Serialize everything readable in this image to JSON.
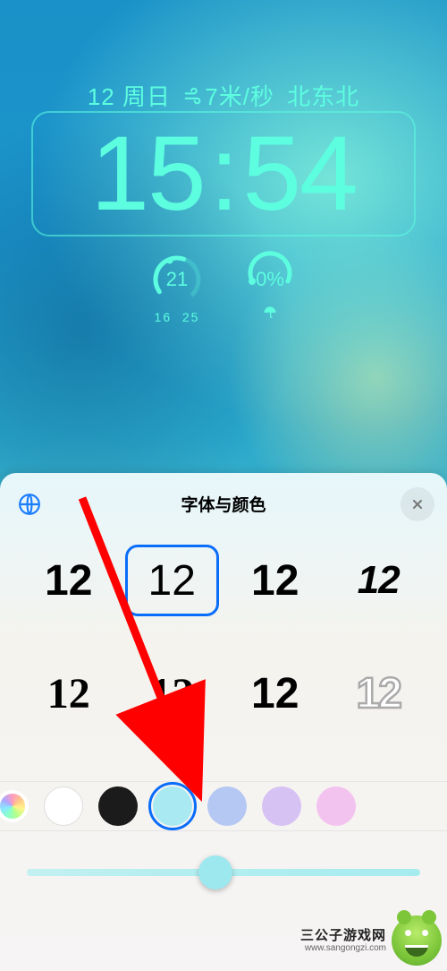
{
  "status_line": {
    "day_number": "12",
    "day_label": "周日",
    "wind_value": "7",
    "wind_unit": "米/秒",
    "wind_dir": "北东北"
  },
  "clock": {
    "hh": "15",
    "mm": "54"
  },
  "gauge_temp": {
    "current": "21",
    "low": "16",
    "high": "25"
  },
  "gauge_rain": {
    "value": "0%"
  },
  "panel": {
    "title": "字体与颜色",
    "sample": "12",
    "selected_font_index": 1,
    "selected_color_index": 2,
    "colors": [
      "#ffffff",
      "#1b1b1b",
      "#a8e9f2",
      "#b4c8f3",
      "#d6c2f3",
      "#f3c3f0"
    ],
    "slider_position_pct": 48
  },
  "watermark": {
    "name": "三公子游戏网",
    "url": "www.sangongzi.com"
  }
}
